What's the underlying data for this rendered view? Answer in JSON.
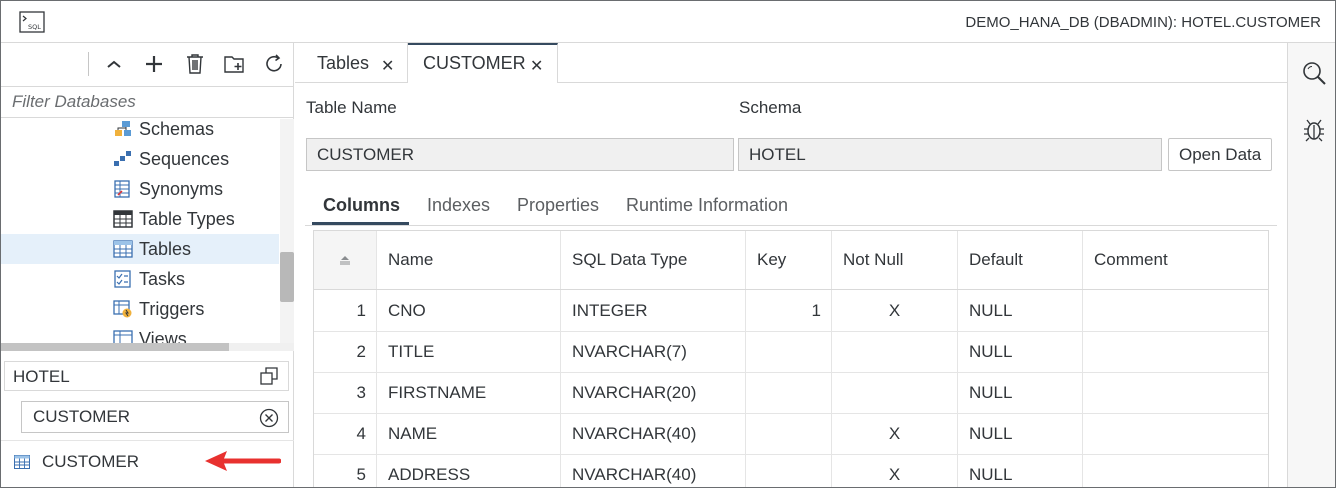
{
  "window": {
    "icon": "sql-console-icon",
    "connection_label": "DEMO_HANA_DB (DBADMIN): HOTEL.CUSTOMER"
  },
  "left_panel": {
    "toolbar": {
      "icons": [
        "collapse-icon",
        "add-icon",
        "delete-icon",
        "add-folder-icon",
        "refresh-icon"
      ]
    },
    "filter": {
      "placeholder": "Filter Databases",
      "value": ""
    },
    "tree": {
      "items": [
        {
          "label": "Schemas",
          "icon": "schemas-icon",
          "selected": false
        },
        {
          "label": "Sequences",
          "icon": "sequences-icon",
          "selected": false
        },
        {
          "label": "Synonyms",
          "icon": "synonyms-icon",
          "selected": false
        },
        {
          "label": "Table Types",
          "icon": "table-types-icon",
          "selected": false
        },
        {
          "label": "Tables",
          "icon": "tables-icon",
          "selected": true
        },
        {
          "label": "Tasks",
          "icon": "tasks-icon",
          "selected": false
        },
        {
          "label": "Triggers",
          "icon": "triggers-icon",
          "selected": false
        },
        {
          "label": "Views",
          "icon": "views-icon",
          "selected": false
        }
      ]
    },
    "schema_selector": {
      "value": "HOTEL"
    },
    "object_search": {
      "value": "CUSTOMER"
    },
    "results": [
      {
        "label": "CUSTOMER",
        "icon": "table-icon"
      }
    ]
  },
  "main": {
    "tabs": [
      {
        "label": "Tables",
        "active": false
      },
      {
        "label": "CUSTOMER",
        "active": true
      }
    ],
    "table_name_label": "Table Name",
    "schema_label": "Schema",
    "table_name_value": "CUSTOMER",
    "schema_value": "HOTEL",
    "open_data_label": "Open Data",
    "subtabs": [
      {
        "label": "Columns",
        "active": true
      },
      {
        "label": "Indexes",
        "active": false
      },
      {
        "label": "Properties",
        "active": false
      },
      {
        "label": "Runtime Information",
        "active": false
      }
    ],
    "grid": {
      "sort_icon": "sort-icon",
      "headers": [
        "",
        "Name",
        "SQL Data Type",
        "Key",
        "Not Null",
        "Default",
        "Comment"
      ],
      "rows": [
        {
          "pos": "1",
          "name": "CNO",
          "type": "INTEGER",
          "key": "1",
          "not_null": "X",
          "default": "NULL",
          "comment": ""
        },
        {
          "pos": "2",
          "name": "TITLE",
          "type": "NVARCHAR(7)",
          "key": "",
          "not_null": "",
          "default": "NULL",
          "comment": ""
        },
        {
          "pos": "3",
          "name": "FIRSTNAME",
          "type": "NVARCHAR(20)",
          "key": "",
          "not_null": "",
          "default": "NULL",
          "comment": ""
        },
        {
          "pos": "4",
          "name": "NAME",
          "type": "NVARCHAR(40)",
          "key": "",
          "not_null": "X",
          "default": "NULL",
          "comment": ""
        },
        {
          "pos": "5",
          "name": "ADDRESS",
          "type": "NVARCHAR(40)",
          "key": "",
          "not_null": "X",
          "default": "NULL",
          "comment": ""
        }
      ]
    }
  },
  "right_strip": {
    "icons": [
      "search-icon",
      "debug-icon"
    ]
  },
  "colors": {
    "accent": "#354a5f",
    "selection": "#e5f0fa",
    "annotation_arrow": "#e8312f"
  }
}
